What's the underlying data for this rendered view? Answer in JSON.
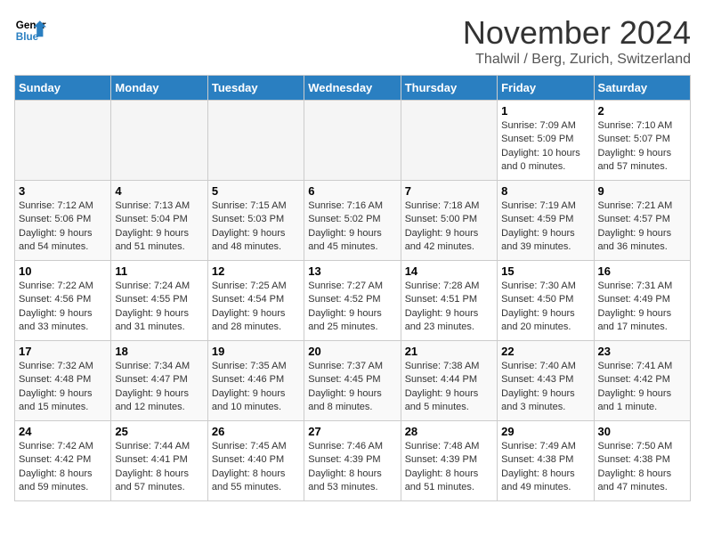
{
  "header": {
    "logo_line1": "General",
    "logo_line2": "Blue",
    "month_year": "November 2024",
    "location": "Thalwil / Berg, Zurich, Switzerland"
  },
  "days_of_week": [
    "Sunday",
    "Monday",
    "Tuesday",
    "Wednesday",
    "Thursday",
    "Friday",
    "Saturday"
  ],
  "weeks": [
    [
      {
        "num": "",
        "detail": ""
      },
      {
        "num": "",
        "detail": ""
      },
      {
        "num": "",
        "detail": ""
      },
      {
        "num": "",
        "detail": ""
      },
      {
        "num": "",
        "detail": ""
      },
      {
        "num": "1",
        "detail": "Sunrise: 7:09 AM\nSunset: 5:09 PM\nDaylight: 10 hours and 0 minutes."
      },
      {
        "num": "2",
        "detail": "Sunrise: 7:10 AM\nSunset: 5:07 PM\nDaylight: 9 hours and 57 minutes."
      }
    ],
    [
      {
        "num": "3",
        "detail": "Sunrise: 7:12 AM\nSunset: 5:06 PM\nDaylight: 9 hours and 54 minutes."
      },
      {
        "num": "4",
        "detail": "Sunrise: 7:13 AM\nSunset: 5:04 PM\nDaylight: 9 hours and 51 minutes."
      },
      {
        "num": "5",
        "detail": "Sunrise: 7:15 AM\nSunset: 5:03 PM\nDaylight: 9 hours and 48 minutes."
      },
      {
        "num": "6",
        "detail": "Sunrise: 7:16 AM\nSunset: 5:02 PM\nDaylight: 9 hours and 45 minutes."
      },
      {
        "num": "7",
        "detail": "Sunrise: 7:18 AM\nSunset: 5:00 PM\nDaylight: 9 hours and 42 minutes."
      },
      {
        "num": "8",
        "detail": "Sunrise: 7:19 AM\nSunset: 4:59 PM\nDaylight: 9 hours and 39 minutes."
      },
      {
        "num": "9",
        "detail": "Sunrise: 7:21 AM\nSunset: 4:57 PM\nDaylight: 9 hours and 36 minutes."
      }
    ],
    [
      {
        "num": "10",
        "detail": "Sunrise: 7:22 AM\nSunset: 4:56 PM\nDaylight: 9 hours and 33 minutes."
      },
      {
        "num": "11",
        "detail": "Sunrise: 7:24 AM\nSunset: 4:55 PM\nDaylight: 9 hours and 31 minutes."
      },
      {
        "num": "12",
        "detail": "Sunrise: 7:25 AM\nSunset: 4:54 PM\nDaylight: 9 hours and 28 minutes."
      },
      {
        "num": "13",
        "detail": "Sunrise: 7:27 AM\nSunset: 4:52 PM\nDaylight: 9 hours and 25 minutes."
      },
      {
        "num": "14",
        "detail": "Sunrise: 7:28 AM\nSunset: 4:51 PM\nDaylight: 9 hours and 23 minutes."
      },
      {
        "num": "15",
        "detail": "Sunrise: 7:30 AM\nSunset: 4:50 PM\nDaylight: 9 hours and 20 minutes."
      },
      {
        "num": "16",
        "detail": "Sunrise: 7:31 AM\nSunset: 4:49 PM\nDaylight: 9 hours and 17 minutes."
      }
    ],
    [
      {
        "num": "17",
        "detail": "Sunrise: 7:32 AM\nSunset: 4:48 PM\nDaylight: 9 hours and 15 minutes."
      },
      {
        "num": "18",
        "detail": "Sunrise: 7:34 AM\nSunset: 4:47 PM\nDaylight: 9 hours and 12 minutes."
      },
      {
        "num": "19",
        "detail": "Sunrise: 7:35 AM\nSunset: 4:46 PM\nDaylight: 9 hours and 10 minutes."
      },
      {
        "num": "20",
        "detail": "Sunrise: 7:37 AM\nSunset: 4:45 PM\nDaylight: 9 hours and 8 minutes."
      },
      {
        "num": "21",
        "detail": "Sunrise: 7:38 AM\nSunset: 4:44 PM\nDaylight: 9 hours and 5 minutes."
      },
      {
        "num": "22",
        "detail": "Sunrise: 7:40 AM\nSunset: 4:43 PM\nDaylight: 9 hours and 3 minutes."
      },
      {
        "num": "23",
        "detail": "Sunrise: 7:41 AM\nSunset: 4:42 PM\nDaylight: 9 hours and 1 minute."
      }
    ],
    [
      {
        "num": "24",
        "detail": "Sunrise: 7:42 AM\nSunset: 4:42 PM\nDaylight: 8 hours and 59 minutes."
      },
      {
        "num": "25",
        "detail": "Sunrise: 7:44 AM\nSunset: 4:41 PM\nDaylight: 8 hours and 57 minutes."
      },
      {
        "num": "26",
        "detail": "Sunrise: 7:45 AM\nSunset: 4:40 PM\nDaylight: 8 hours and 55 minutes."
      },
      {
        "num": "27",
        "detail": "Sunrise: 7:46 AM\nSunset: 4:39 PM\nDaylight: 8 hours and 53 minutes."
      },
      {
        "num": "28",
        "detail": "Sunrise: 7:48 AM\nSunset: 4:39 PM\nDaylight: 8 hours and 51 minutes."
      },
      {
        "num": "29",
        "detail": "Sunrise: 7:49 AM\nSunset: 4:38 PM\nDaylight: 8 hours and 49 minutes."
      },
      {
        "num": "30",
        "detail": "Sunrise: 7:50 AM\nSunset: 4:38 PM\nDaylight: 8 hours and 47 minutes."
      }
    ]
  ]
}
